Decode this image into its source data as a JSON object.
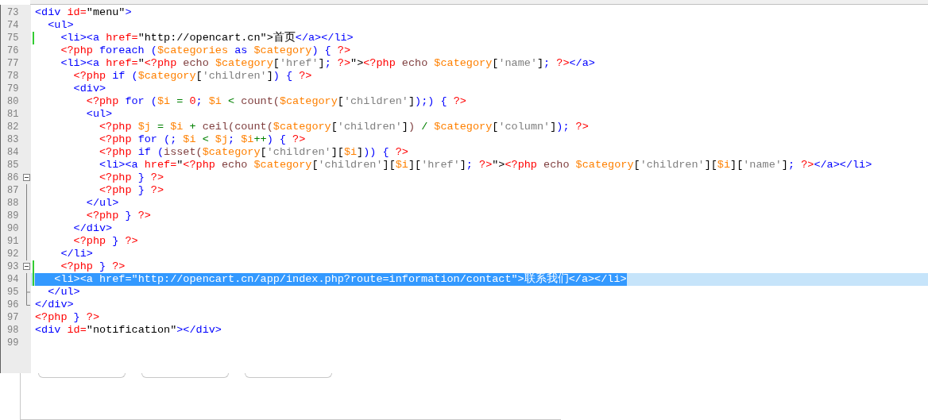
{
  "lines": [
    {
      "number": "73",
      "tokens": [
        {
          "kind": "tag",
          "text": "<div "
        },
        {
          "kind": "attr",
          "text": "id="
        },
        {
          "kind": "str",
          "text": "\"menu\""
        },
        {
          "kind": "tag",
          "text": ">"
        }
      ]
    },
    {
      "number": "74",
      "tokens": [
        {
          "kind": "tag",
          "text": "  <ul>"
        }
      ]
    },
    {
      "number": "75",
      "changed": true,
      "tokens": [
        {
          "kind": "tag",
          "text": "    <li><a "
        },
        {
          "kind": "attr",
          "text": "href="
        },
        {
          "kind": "str",
          "text": "\"http://opencart.cn\">首页"
        },
        {
          "kind": "tag",
          "text": "</a></li>"
        }
      ]
    },
    {
      "number": "76",
      "tokens": [
        {
          "kind": "php",
          "text": "    <?php "
        },
        {
          "kind": "kw",
          "text": "foreach "
        },
        {
          "kind": "pb",
          "text": "("
        },
        {
          "kind": "var",
          "text": "$categories "
        },
        {
          "kind": "kw",
          "text": "as "
        },
        {
          "kind": "var",
          "text": "$category"
        },
        {
          "kind": "pb",
          "text": ") { "
        },
        {
          "kind": "php",
          "text": "?>"
        }
      ]
    },
    {
      "number": "77",
      "tokens": [
        {
          "kind": "tag",
          "text": "    <li><a "
        },
        {
          "kind": "attr",
          "text": "href="
        },
        {
          "kind": "str",
          "text": "\""
        },
        {
          "kind": "php",
          "text": "<?php "
        },
        {
          "kind": "fn",
          "text": "echo "
        },
        {
          "kind": "var",
          "text": "$category"
        },
        {
          "kind": "p",
          "text": "["
        },
        {
          "kind": "lit",
          "text": "'href'"
        },
        {
          "kind": "p",
          "text": "]"
        },
        {
          "kind": "pb",
          "text": "; "
        },
        {
          "kind": "php",
          "text": "?>"
        },
        {
          "kind": "str",
          "text": "\">"
        },
        {
          "kind": "php",
          "text": "<?php "
        },
        {
          "kind": "fn",
          "text": "echo "
        },
        {
          "kind": "var",
          "text": "$category"
        },
        {
          "kind": "p",
          "text": "["
        },
        {
          "kind": "lit",
          "text": "'name'"
        },
        {
          "kind": "p",
          "text": "]"
        },
        {
          "kind": "pb",
          "text": "; "
        },
        {
          "kind": "php",
          "text": "?>"
        },
        {
          "kind": "tag",
          "text": "</a>"
        }
      ]
    },
    {
      "number": "78",
      "tokens": [
        {
          "kind": "php",
          "text": "      <?php "
        },
        {
          "kind": "kw",
          "text": "if "
        },
        {
          "kind": "pb",
          "text": "("
        },
        {
          "kind": "var",
          "text": "$category"
        },
        {
          "kind": "p",
          "text": "["
        },
        {
          "kind": "lit",
          "text": "'children'"
        },
        {
          "kind": "p",
          "text": "]"
        },
        {
          "kind": "pb",
          "text": ") { "
        },
        {
          "kind": "php",
          "text": "?>"
        }
      ]
    },
    {
      "number": "79",
      "tokens": [
        {
          "kind": "tag",
          "text": "      <div>"
        }
      ]
    },
    {
      "number": "80",
      "tokens": [
        {
          "kind": "php",
          "text": "        <?php "
        },
        {
          "kind": "kw",
          "text": "for "
        },
        {
          "kind": "pb",
          "text": "("
        },
        {
          "kind": "var",
          "text": "$i "
        },
        {
          "kind": "op",
          "text": "= "
        },
        {
          "kind": "num",
          "text": "0"
        },
        {
          "kind": "pb",
          "text": "; "
        },
        {
          "kind": "var",
          "text": "$i "
        },
        {
          "kind": "op",
          "text": "< "
        },
        {
          "kind": "fn",
          "text": "count("
        },
        {
          "kind": "var",
          "text": "$category"
        },
        {
          "kind": "p",
          "text": "["
        },
        {
          "kind": "lit",
          "text": "'children'"
        },
        {
          "kind": "p",
          "text": "]"
        },
        {
          "kind": "pb",
          "text": ");) { "
        },
        {
          "kind": "php",
          "text": "?>"
        }
      ]
    },
    {
      "number": "81",
      "tokens": [
        {
          "kind": "tag",
          "text": "        <ul>"
        }
      ]
    },
    {
      "number": "82",
      "tokens": [
        {
          "kind": "php",
          "text": "          <?php "
        },
        {
          "kind": "var",
          "text": "$j "
        },
        {
          "kind": "op",
          "text": "= "
        },
        {
          "kind": "var",
          "text": "$i "
        },
        {
          "kind": "op",
          "text": "+ "
        },
        {
          "kind": "fn",
          "text": "ceil(count("
        },
        {
          "kind": "var",
          "text": "$category"
        },
        {
          "kind": "p",
          "text": "["
        },
        {
          "kind": "lit",
          "text": "'children'"
        },
        {
          "kind": "p",
          "text": "]"
        },
        {
          "kind": "fn",
          "text": ") "
        },
        {
          "kind": "op",
          "text": "/ "
        },
        {
          "kind": "var",
          "text": "$category"
        },
        {
          "kind": "p",
          "text": "["
        },
        {
          "kind": "lit",
          "text": "'column'"
        },
        {
          "kind": "p",
          "text": "]"
        },
        {
          "kind": "pb",
          "text": "); "
        },
        {
          "kind": "php",
          "text": "?>"
        }
      ]
    },
    {
      "number": "83",
      "tokens": [
        {
          "kind": "php",
          "text": "          <?php "
        },
        {
          "kind": "kw",
          "text": "for "
        },
        {
          "kind": "pb",
          "text": "(; "
        },
        {
          "kind": "var",
          "text": "$i "
        },
        {
          "kind": "op",
          "text": "< "
        },
        {
          "kind": "var",
          "text": "$j"
        },
        {
          "kind": "pb",
          "text": "; "
        },
        {
          "kind": "var",
          "text": "$i"
        },
        {
          "kind": "op",
          "text": "++"
        },
        {
          "kind": "pb",
          "text": ") { "
        },
        {
          "kind": "php",
          "text": "?>"
        }
      ]
    },
    {
      "number": "84",
      "tokens": [
        {
          "kind": "php",
          "text": "          <?php "
        },
        {
          "kind": "kw",
          "text": "if "
        },
        {
          "kind": "pb",
          "text": "("
        },
        {
          "kind": "fn",
          "text": "isset("
        },
        {
          "kind": "var",
          "text": "$category"
        },
        {
          "kind": "p",
          "text": "["
        },
        {
          "kind": "lit",
          "text": "'children'"
        },
        {
          "kind": "p",
          "text": "]["
        },
        {
          "kind": "var",
          "text": "$i"
        },
        {
          "kind": "p",
          "text": "]"
        },
        {
          "kind": "pb",
          "text": ")) { "
        },
        {
          "kind": "php",
          "text": "?>"
        }
      ]
    },
    {
      "number": "85",
      "tokens": [
        {
          "kind": "tag",
          "text": "          <li><a "
        },
        {
          "kind": "attr",
          "text": "href="
        },
        {
          "kind": "str",
          "text": "\""
        },
        {
          "kind": "php",
          "text": "<?php "
        },
        {
          "kind": "fn",
          "text": "echo "
        },
        {
          "kind": "var",
          "text": "$category"
        },
        {
          "kind": "p",
          "text": "["
        },
        {
          "kind": "lit",
          "text": "'children'"
        },
        {
          "kind": "p",
          "text": "]["
        },
        {
          "kind": "var",
          "text": "$i"
        },
        {
          "kind": "p",
          "text": "]["
        },
        {
          "kind": "lit",
          "text": "'href'"
        },
        {
          "kind": "p",
          "text": "]"
        },
        {
          "kind": "pb",
          "text": "; "
        },
        {
          "kind": "php",
          "text": "?>"
        },
        {
          "kind": "str",
          "text": "\">"
        },
        {
          "kind": "php",
          "text": "<?php "
        },
        {
          "kind": "fn",
          "text": "echo "
        },
        {
          "kind": "var",
          "text": "$category"
        },
        {
          "kind": "p",
          "text": "["
        },
        {
          "kind": "lit",
          "text": "'children'"
        },
        {
          "kind": "p",
          "text": "]["
        },
        {
          "kind": "var",
          "text": "$i"
        },
        {
          "kind": "p",
          "text": "]["
        },
        {
          "kind": "lit",
          "text": "'name'"
        },
        {
          "kind": "p",
          "text": "]"
        },
        {
          "kind": "pb",
          "text": "; "
        },
        {
          "kind": "php",
          "text": "?>"
        },
        {
          "kind": "tag",
          "text": "</a></li>"
        }
      ]
    },
    {
      "number": "86",
      "fold": {
        "kind": "start"
      },
      "tokens": [
        {
          "kind": "php",
          "text": "          <?php "
        },
        {
          "kind": "pb",
          "text": "} "
        },
        {
          "kind": "php",
          "text": "?>"
        }
      ]
    },
    {
      "number": "87",
      "fold": {
        "kind": "line"
      },
      "tokens": [
        {
          "kind": "php",
          "text": "          <?php "
        },
        {
          "kind": "pb",
          "text": "} "
        },
        {
          "kind": "php",
          "text": "?>"
        }
      ]
    },
    {
      "number": "88",
      "fold": {
        "kind": "line"
      },
      "tokens": [
        {
          "kind": "tag",
          "text": "        </ul>"
        }
      ]
    },
    {
      "number": "89",
      "fold": {
        "kind": "line"
      },
      "tokens": [
        {
          "kind": "php",
          "text": "        <?php "
        },
        {
          "kind": "pb",
          "text": "} "
        },
        {
          "kind": "php",
          "text": "?>"
        }
      ]
    },
    {
      "number": "90",
      "fold": {
        "kind": "line"
      },
      "tokens": [
        {
          "kind": "tag",
          "text": "      </div>"
        }
      ]
    },
    {
      "number": "91",
      "fold": {
        "kind": "line"
      },
      "tokens": [
        {
          "kind": "php",
          "text": "      <?php "
        },
        {
          "kind": "pb",
          "text": "} "
        },
        {
          "kind": "php",
          "text": "?>"
        }
      ]
    },
    {
      "number": "92",
      "fold": {
        "kind": "line"
      },
      "tokens": [
        {
          "kind": "tag",
          "text": "    </li>"
        }
      ]
    },
    {
      "number": "93",
      "fold": {
        "kind": "start"
      },
      "changed": true,
      "tokens": [
        {
          "kind": "php",
          "text": "    <?php "
        },
        {
          "kind": "pb",
          "text": "} "
        },
        {
          "kind": "php",
          "text": "?>"
        }
      ]
    },
    {
      "number": "94",
      "fold": {
        "kind": "line"
      },
      "changed": true,
      "selected": true,
      "tokens": [
        {
          "kind": "tag",
          "text": "   <li><a "
        },
        {
          "kind": "attr",
          "text": "href="
        },
        {
          "kind": "str",
          "text": "\"http://opencart.cn/app/index.php?route=information/contact\">联系我们"
        },
        {
          "kind": "tag",
          "text": "</a></li>"
        }
      ]
    },
    {
      "number": "95",
      "fold": {
        "kind": "mid"
      },
      "tokens": [
        {
          "kind": "tag",
          "text": "  </ul>"
        }
      ]
    },
    {
      "number": "96",
      "fold": {
        "kind": "end"
      },
      "tokens": [
        {
          "kind": "tag",
          "text": "</div>"
        }
      ]
    },
    {
      "number": "97",
      "tokens": [
        {
          "kind": "php",
          "text": "<?php "
        },
        {
          "kind": "pb",
          "text": "} "
        },
        {
          "kind": "php",
          "text": "?>"
        }
      ]
    },
    {
      "number": "98",
      "tokens": [
        {
          "kind": "tag",
          "text": "<div "
        },
        {
          "kind": "attr",
          "text": "id="
        },
        {
          "kind": "str",
          "text": "\"notification\""
        },
        {
          "kind": "tag",
          "text": "></div>"
        }
      ]
    },
    {
      "number": "99"
    }
  ]
}
